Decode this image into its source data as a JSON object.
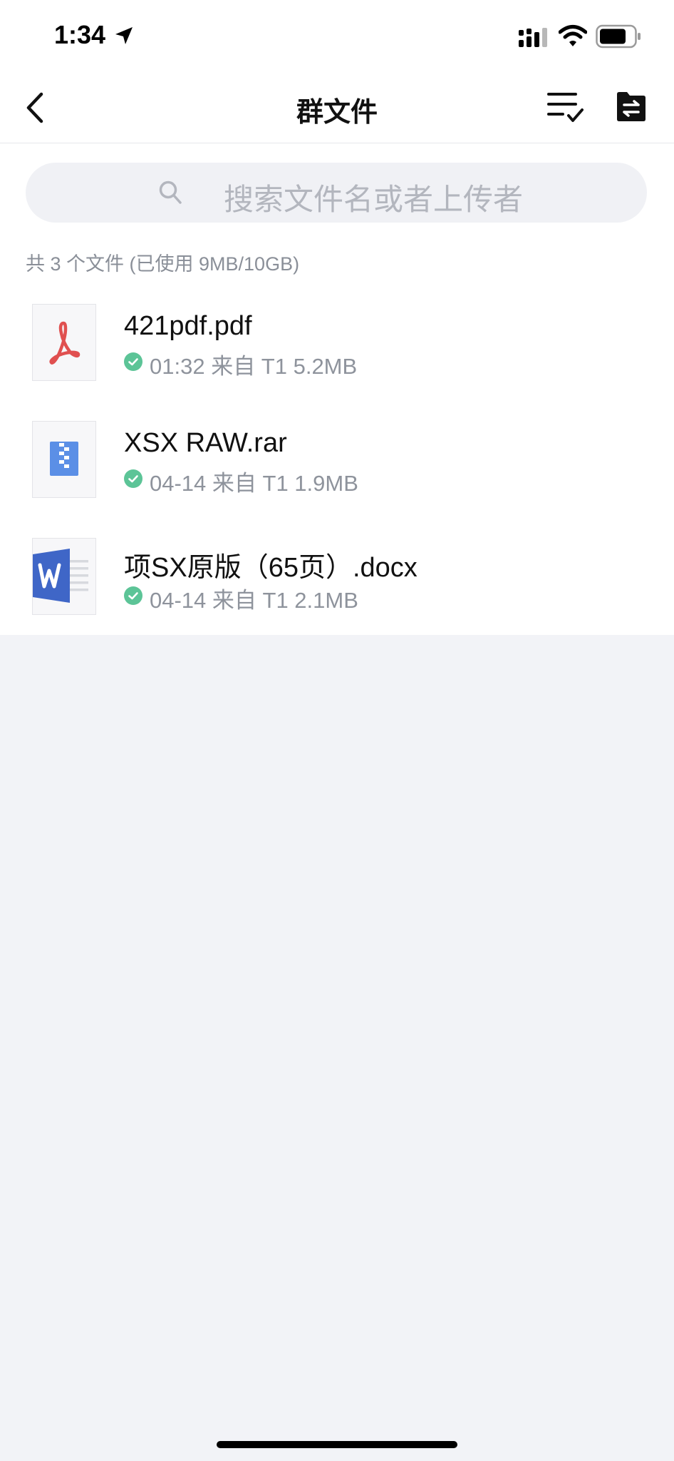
{
  "status_bar": {
    "time": "1:34"
  },
  "nav": {
    "title": "群文件"
  },
  "search": {
    "placeholder": "搜索文件名或者上传者"
  },
  "summary": "共 3 个文件 (已使用 9MB/10GB)",
  "files": [
    {
      "name": "421pdf.pdf",
      "meta": "01:32 来自 T1 5.2MB",
      "type_icon": "pdf-icon"
    },
    {
      "name": "XSX RAW.rar",
      "meta": "04-14 来自 T1 1.9MB",
      "type_icon": "archive-icon"
    },
    {
      "name": "项SX原版（65页）.docx",
      "meta": "04-14 来自 T1 2.1MB",
      "type_icon": "word-icon"
    }
  ],
  "colors": {
    "background": "#f2f3f7",
    "check_green": "#5cc497",
    "pdf_red": "#e05050",
    "archive_blue": "#5b8fe6",
    "word_blue": "#3f66c7"
  }
}
